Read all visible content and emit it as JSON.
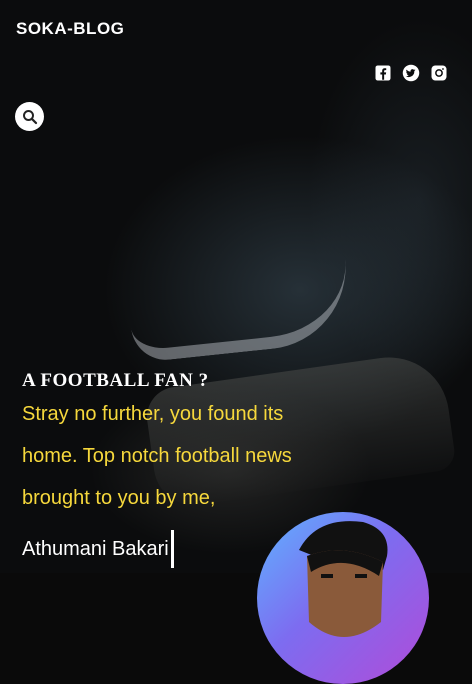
{
  "site": {
    "title": "SOKA-BLOG"
  },
  "social": [
    {
      "icon": "facebook-icon",
      "label": "Facebook"
    },
    {
      "icon": "twitter-icon",
      "label": "Twitter"
    },
    {
      "icon": "instagram-icon",
      "label": "Instagram"
    }
  ],
  "search": {
    "icon": "search-icon"
  },
  "intro": {
    "heading": "A FOOTBALL FAN ?",
    "lines": [
      "Stray no further, you found its",
      "home. Top notch football news",
      "brought to you by me,"
    ],
    "typed_name": "Athumani Bakari"
  },
  "colors": {
    "accent": "#f6d83c",
    "text": "#ffffff",
    "background": "#0b0c0d"
  }
}
